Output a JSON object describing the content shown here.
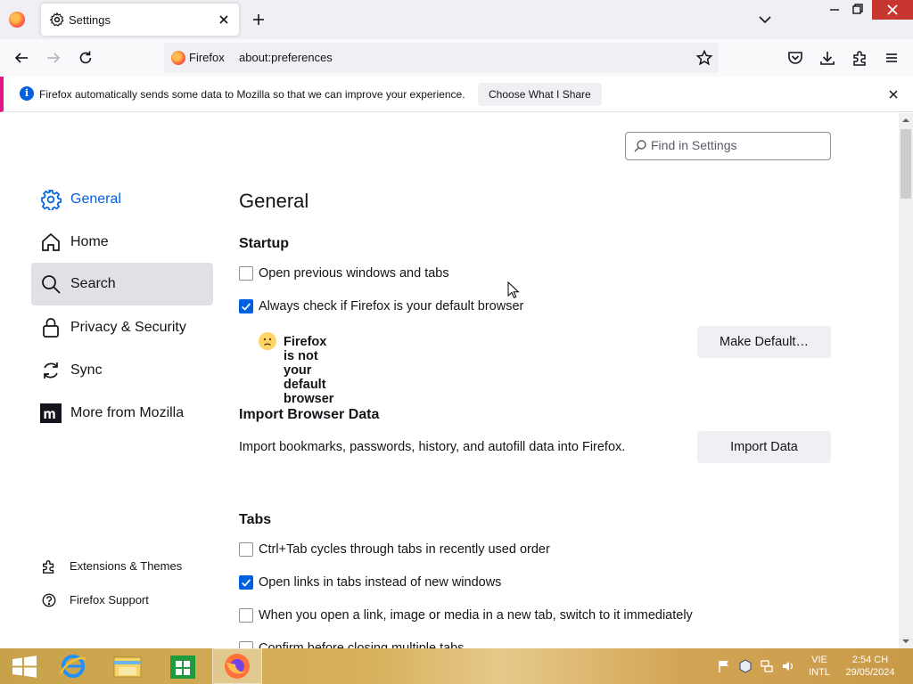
{
  "browser": {
    "tab": {
      "title": "Settings"
    },
    "identity_label": "Firefox",
    "url": "about:preferences"
  },
  "notification": {
    "message": "Firefox automatically sends some data to Mozilla so that we can improve your experience.",
    "button": "Choose What I Share"
  },
  "search": {
    "placeholder": "Find in Settings"
  },
  "sidebar": {
    "categories": [
      {
        "label": "General",
        "icon": "gear-icon",
        "selected": true
      },
      {
        "label": "Home",
        "icon": "home-icon"
      },
      {
        "label": "Search",
        "icon": "search-icon",
        "hovered": true
      },
      {
        "label": "Privacy & Security",
        "icon": "lock-icon"
      },
      {
        "label": "Sync",
        "icon": "sync-icon"
      },
      {
        "label": "More from Mozilla",
        "icon": "mozilla-icon"
      }
    ],
    "footer": [
      {
        "label": "Extensions & Themes",
        "icon": "puzzle-icon"
      },
      {
        "label": "Firefox Support",
        "icon": "help-icon"
      }
    ]
  },
  "main": {
    "title": "General",
    "startup": {
      "heading": "Startup",
      "open_previous": {
        "label": "Open previous windows and tabs",
        "checked": false
      },
      "check_default": {
        "label": "Always check if Firefox is your default browser",
        "checked": true
      },
      "not_default": "Firefox is not your default browser",
      "make_default": "Make Default…"
    },
    "import": {
      "heading": "Import Browser Data",
      "description": "Import bookmarks, passwords, history, and autofill data into Firefox.",
      "button": "Import Data"
    },
    "tabs": {
      "heading": "Tabs",
      "items": [
        {
          "label": "Ctrl+Tab cycles through tabs in recently used order",
          "checked": false
        },
        {
          "label": "Open links in tabs instead of new windows",
          "checked": true
        },
        {
          "label": "When you open a link, image or media in a new tab, switch to it immediately",
          "checked": false
        },
        {
          "label": "Confirm before closing multiple tabs",
          "checked": false
        }
      ]
    }
  },
  "taskbar": {
    "lang_top": "VIE",
    "lang_bottom": "INTL",
    "time": "2:54 CH",
    "date": "29/05/2024"
  },
  "colors": {
    "accent": "#0061e0",
    "close": "#c7372f"
  }
}
